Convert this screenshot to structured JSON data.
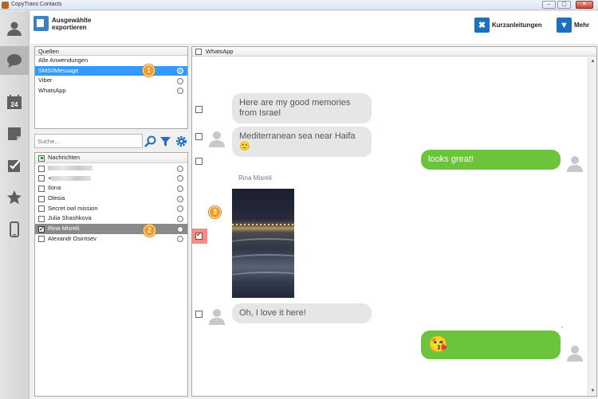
{
  "window": {
    "title": "CopyTrans Contacts"
  },
  "toolbar": {
    "export_label": "Ausgewählte exportieren",
    "guides_label": "Kurzanleitungen",
    "more_label": "Mehr"
  },
  "sources": {
    "header": "Quellen",
    "items": [
      {
        "label": "Alle Anwendungen",
        "icon": "none"
      },
      {
        "label": "SMS/iMessage",
        "icon": "message-icon",
        "selected": true
      },
      {
        "label": "Viber",
        "icon": "viber-icon"
      },
      {
        "label": "WhatsApp",
        "icon": "whatsapp-icon"
      }
    ]
  },
  "search": {
    "placeholder": "Suche..."
  },
  "contacts": {
    "header": "Nachrichten",
    "items": [
      {
        "label": "",
        "redacted": true
      },
      {
        "label": "+",
        "redacted": true
      },
      {
        "label": "Ilona"
      },
      {
        "label": "Olesia"
      },
      {
        "label": "Secret owl mission"
      },
      {
        "label": "Julia Shashkova"
      },
      {
        "label": "Rina Misreli",
        "checked": true,
        "selected": true
      },
      {
        "label": "Alexandr Osintsev"
      }
    ]
  },
  "badges": {
    "one": "1",
    "two": "2",
    "three": "3"
  },
  "chat": {
    "header": "WhatsApp",
    "messages": [
      {
        "dir": "in",
        "text": "Here are my good memories from Israel"
      },
      {
        "dir": "in",
        "text": "Mediterranean sea near Haifa 🙂"
      },
      {
        "dir": "out",
        "text": "looks great!"
      },
      {
        "dir": "in",
        "sender": "Rina Misreli",
        "media": "photo",
        "checked": true
      },
      {
        "dir": "in",
        "text": "Oh, I love it here!"
      },
      {
        "dir": "out",
        "text": "😘"
      }
    ]
  },
  "colors": {
    "selection_blue": "#3399ff",
    "outgoing_bubble": "#6cc33c",
    "incoming_bubble": "#e6e6e6",
    "badge_orange": "#f39a1e",
    "accent_blue": "#1d6fc0"
  }
}
